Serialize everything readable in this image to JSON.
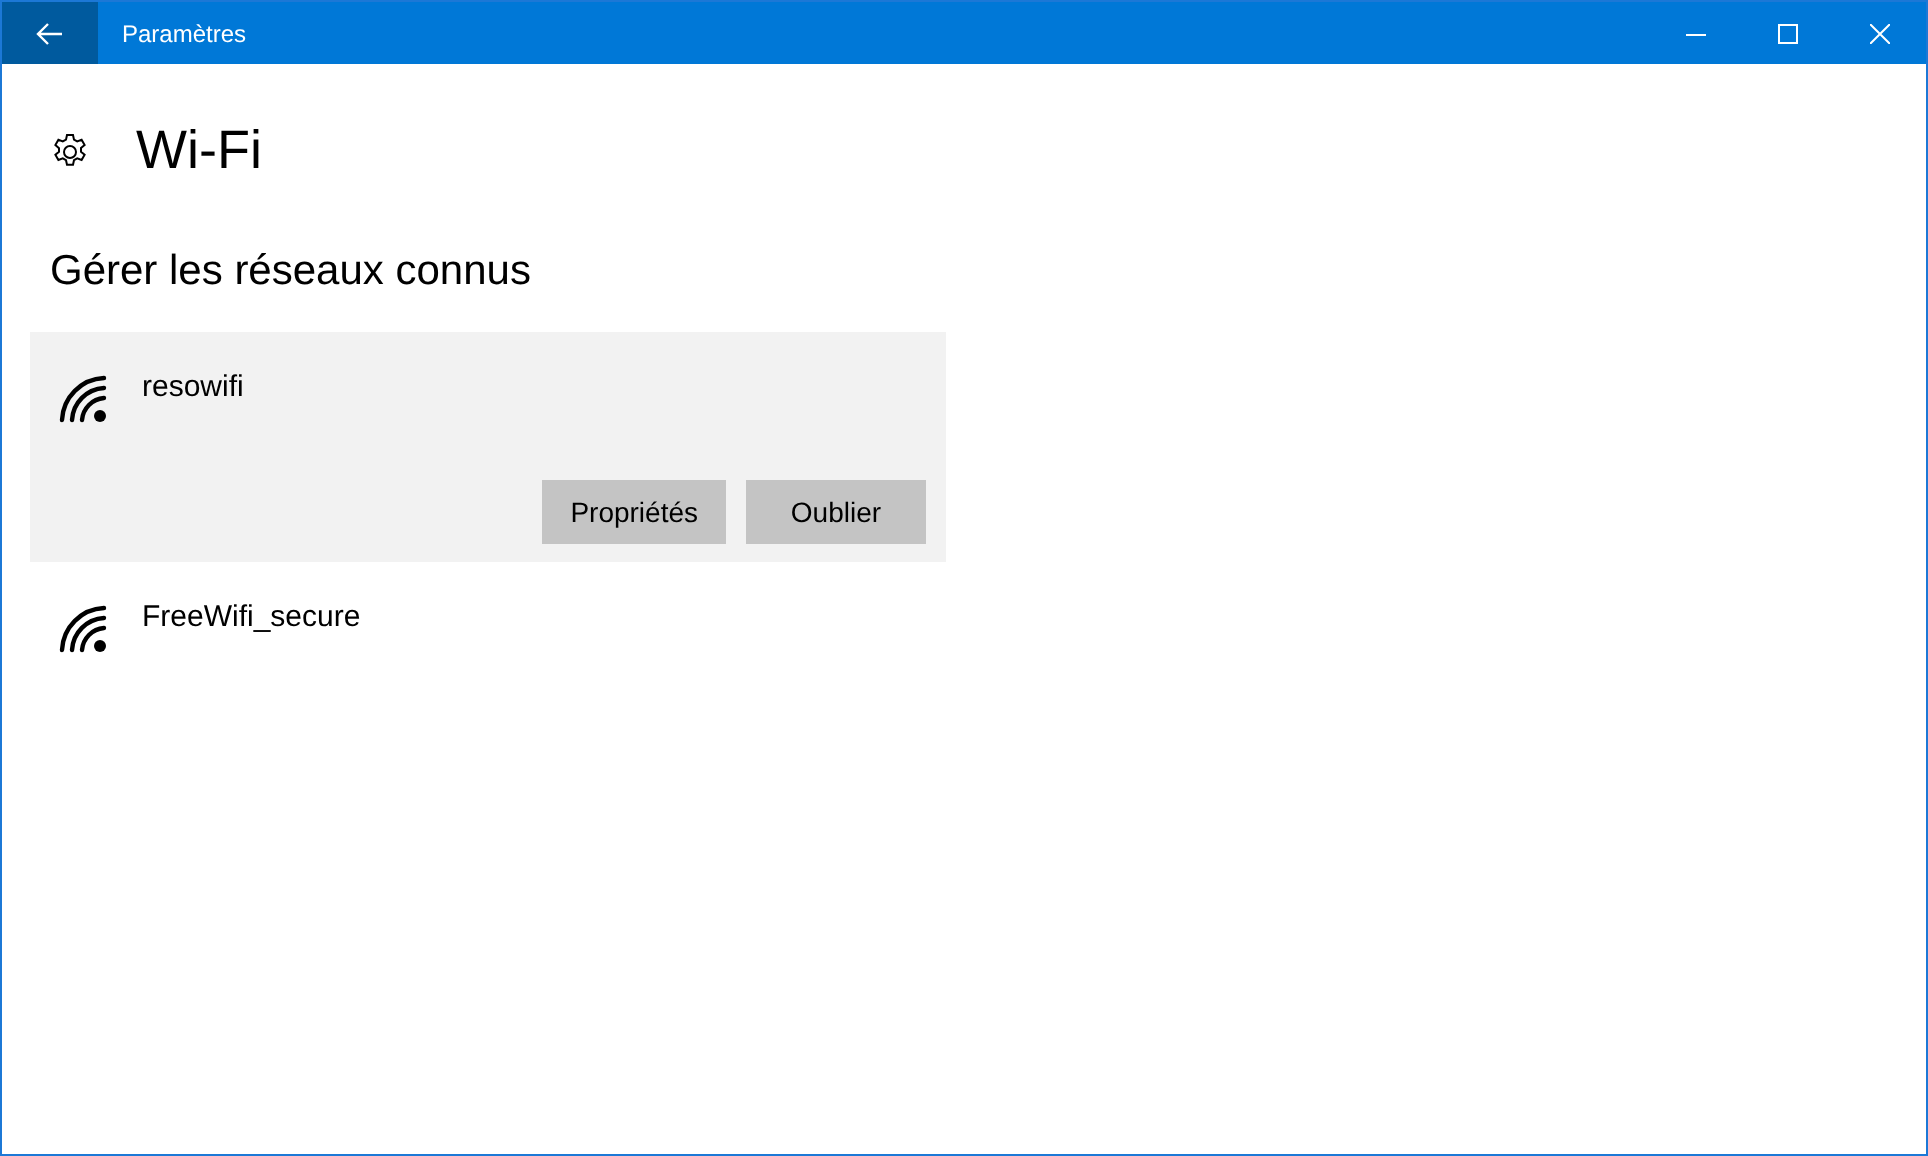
{
  "window": {
    "title": "Paramètres"
  },
  "page": {
    "title": "Wi-Fi"
  },
  "section": {
    "title": "Gérer les réseaux connus"
  },
  "networks": [
    {
      "name": "resowifi",
      "selected": true,
      "buttons": [
        "Propriétés",
        "Oublier"
      ]
    },
    {
      "name": "FreeWifi_secure",
      "selected": false
    }
  ]
}
